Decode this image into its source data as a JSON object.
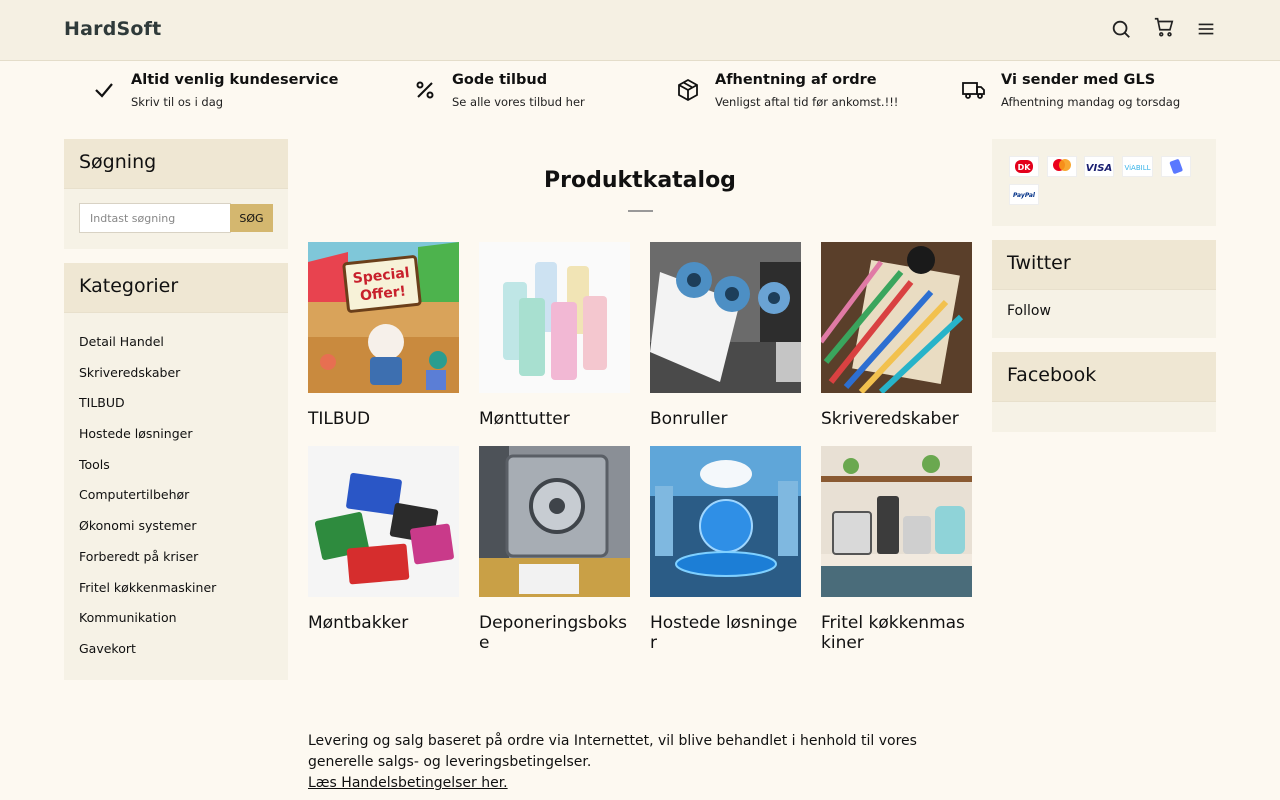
{
  "header": {
    "brand": "HardSoft",
    "icons": [
      "search-icon",
      "cart-icon",
      "menu-icon"
    ]
  },
  "features": [
    {
      "title": "Altid venlig kundeservice",
      "subtitle": "Skriv til os i dag",
      "icon": "checkmark-icon"
    },
    {
      "title": "Gode tilbud",
      "subtitle": "Se alle vores tilbud her",
      "icon": "percent-icon"
    },
    {
      "title": "Afhentning af ordre",
      "subtitle": "Venligst aftal tid før ankomst.!!!",
      "icon": "package-icon"
    },
    {
      "title": "Vi sender med GLS",
      "subtitle": "Afhentning mandag og torsdag",
      "icon": "truck-icon"
    }
  ],
  "search": {
    "title": "Søgning",
    "placeholder": "Indtast søgning",
    "button": "SØG"
  },
  "categories": {
    "title": "Kategorier",
    "items": [
      "Detail Handel",
      "Skriveredskaber",
      "TILBUD",
      "Hostede løsninger",
      "Tools",
      "Computertilbehør",
      "Økonomi systemer",
      "Forberedt på kriser",
      "Fritel køkkenmaskiner",
      "Kommunikation",
      "Gavekort"
    ]
  },
  "catalog": {
    "title": "Produktkatalog",
    "products": [
      "TILBUD",
      "Mønttutter",
      "Bonruller",
      "Skriveredskaber",
      "Møntbakker",
      "Deponeringsboks e",
      "Hostede løsninger",
      "Fritel køkkenmaskiner"
    ]
  },
  "info": {
    "text": "Levering og salg baseret på ordre via Internettet, vil blive behandlet i henhold til vores generelle salgs- og leveringsbetingelser.",
    "link": "Læs Handelsbetingelser her."
  },
  "payments": [
    "Dankort",
    "Mastercard",
    "VISA",
    "MobilePay",
    "ViaBill",
    "PayPal"
  ],
  "twitter": {
    "title": "Twitter",
    "follow": "Follow"
  },
  "facebook": {
    "title": "Facebook"
  }
}
